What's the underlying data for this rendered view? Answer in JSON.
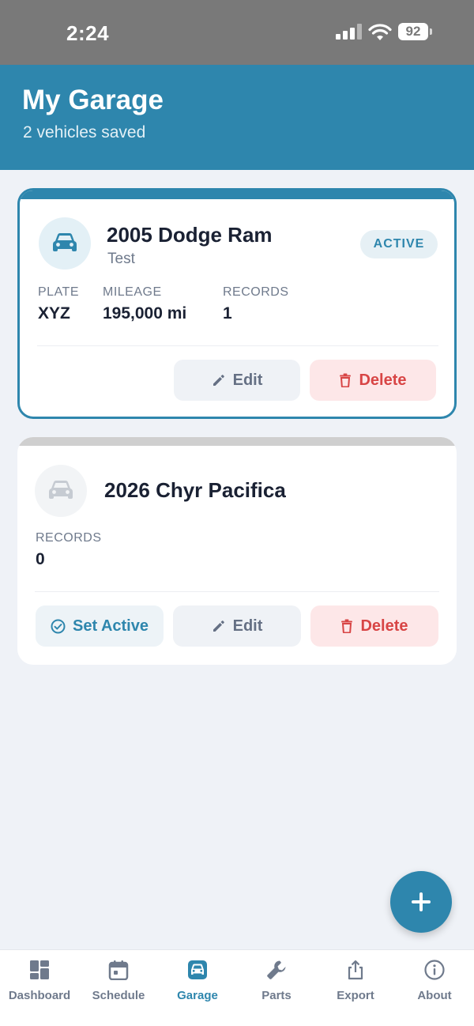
{
  "status_bar": {
    "time": "2:24",
    "battery": "92"
  },
  "header": {
    "title": "My Garage",
    "subtitle": "2 vehicles saved"
  },
  "vehicles": [
    {
      "title": "2005 Dodge Ram",
      "nickname": "Test",
      "badge": "ACTIVE",
      "stats": [
        {
          "label": "PLATE",
          "value": "XYZ"
        },
        {
          "label": "MILEAGE",
          "value": "195,000 mi"
        },
        {
          "label": "RECORDS",
          "value": "1"
        }
      ],
      "edit_label": "Edit",
      "delete_label": "Delete"
    },
    {
      "title": "2026 Chyr Pacifica",
      "stats": [
        {
          "label": "RECORDS",
          "value": "0"
        }
      ],
      "set_active_label": "Set Active",
      "edit_label": "Edit",
      "delete_label": "Delete"
    }
  ],
  "tabs": [
    {
      "label": "Dashboard",
      "icon": "dashboard-icon"
    },
    {
      "label": "Schedule",
      "icon": "calendar-icon"
    },
    {
      "label": "Garage",
      "icon": "car-icon",
      "active": true
    },
    {
      "label": "Parts",
      "icon": "wrench-icon"
    },
    {
      "label": "Export",
      "icon": "share-icon"
    },
    {
      "label": "About",
      "icon": "info-icon"
    }
  ],
  "colors": {
    "primary": "#2e86ad",
    "danger": "#d84545",
    "background": "#eff2f7",
    "status_bar": "#797979"
  }
}
